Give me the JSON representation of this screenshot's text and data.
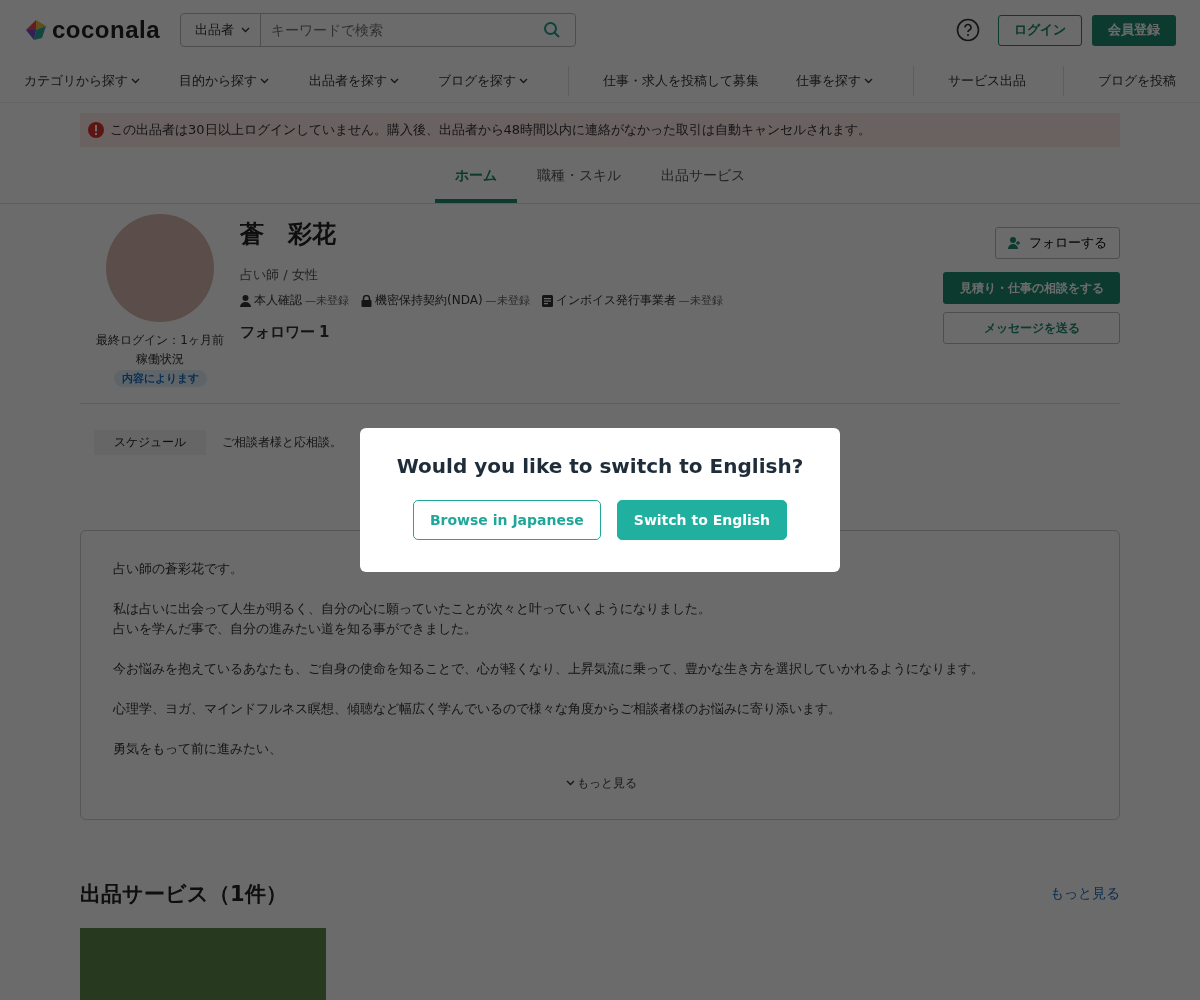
{
  "header": {
    "logo_text": "coconala",
    "search": {
      "scope": "出品者",
      "placeholder": "キーワードで検索"
    },
    "login": "ログイン",
    "register": "会員登録"
  },
  "nav": [
    {
      "label": "カテゴリから探す",
      "dropdown": true,
      "separated": false
    },
    {
      "label": "目的から探す",
      "dropdown": true,
      "separated": false
    },
    {
      "label": "出品者を探す",
      "dropdown": true,
      "separated": false
    },
    {
      "label": "ブログを探す",
      "dropdown": true,
      "separated": false
    },
    {
      "label": "仕事・求人を投稿して募集",
      "dropdown": false,
      "separated": true
    },
    {
      "label": "仕事を探す",
      "dropdown": true,
      "separated": false
    },
    {
      "label": "サービス出品",
      "dropdown": false,
      "separated": true
    },
    {
      "label": "ブログを投稿",
      "dropdown": false,
      "separated": true
    }
  ],
  "alert": "この出品者は30日以上ログインしていません。購入後、出品者から48時間以内に連絡がなかった取引は自動キャンセルされます。",
  "tabs": [
    {
      "label": "ホーム",
      "selected": true
    },
    {
      "label": "職種・スキル",
      "selected": false
    },
    {
      "label": "出品サービス",
      "selected": false
    }
  ],
  "profile": {
    "name": "蒼　彩花",
    "subtitle": "占い師 / 女性",
    "last_login": "最終ログイン：1ヶ月前",
    "activity_label": "稼働状況",
    "activity_value": "内容によります",
    "badges": [
      {
        "kind": "person",
        "label": "本人確認",
        "status": "—未登録"
      },
      {
        "kind": "lock",
        "label": "機密保持契約(NDA)",
        "status": "—未登録"
      },
      {
        "kind": "document",
        "label": "インボイス発行事業者",
        "status": "—未登録"
      }
    ],
    "followers_label": "フォロワー",
    "followers_count": "1",
    "follow_button": "フォローする",
    "consult_button": "見積り・仕事の相談をする",
    "message_button": "メッセージを送る"
  },
  "schedule": {
    "label": "スケジュール",
    "text": "ご相談者様と応相談。"
  },
  "bio": {
    "paragraphs": [
      [
        "占い師の蒼彩花です。"
      ],
      [
        "私は占いに出会って人生が明るく、自分の心に願っていたことが次々と叶っていくようになりました。",
        "占いを学んだ事で、自分の進みたい道を知る事ができました。"
      ],
      [
        "今お悩みを抱えているあなたも、ご自身の使命を知ることで、心が軽くなり、上昇気流に乗って、豊かな生き方を選択していかれるようになります。"
      ],
      [
        "心理学、ヨガ、マインドフルネス瞑想、傾聴など幅広く学んでいるので様々な角度からご相談者様のお悩みに寄り添います。"
      ],
      [
        "勇気をもって前に進みたい、"
      ]
    ],
    "more": "もっと見る"
  },
  "services": {
    "title": "出品サービス（1件）",
    "more": "もっと見る"
  },
  "modal": {
    "title": "Would you like to switch to English?",
    "buttons": [
      {
        "label": "Browse in Japanese",
        "kind": "outline"
      },
      {
        "label": "Switch to English",
        "kind": "primary"
      }
    ]
  }
}
